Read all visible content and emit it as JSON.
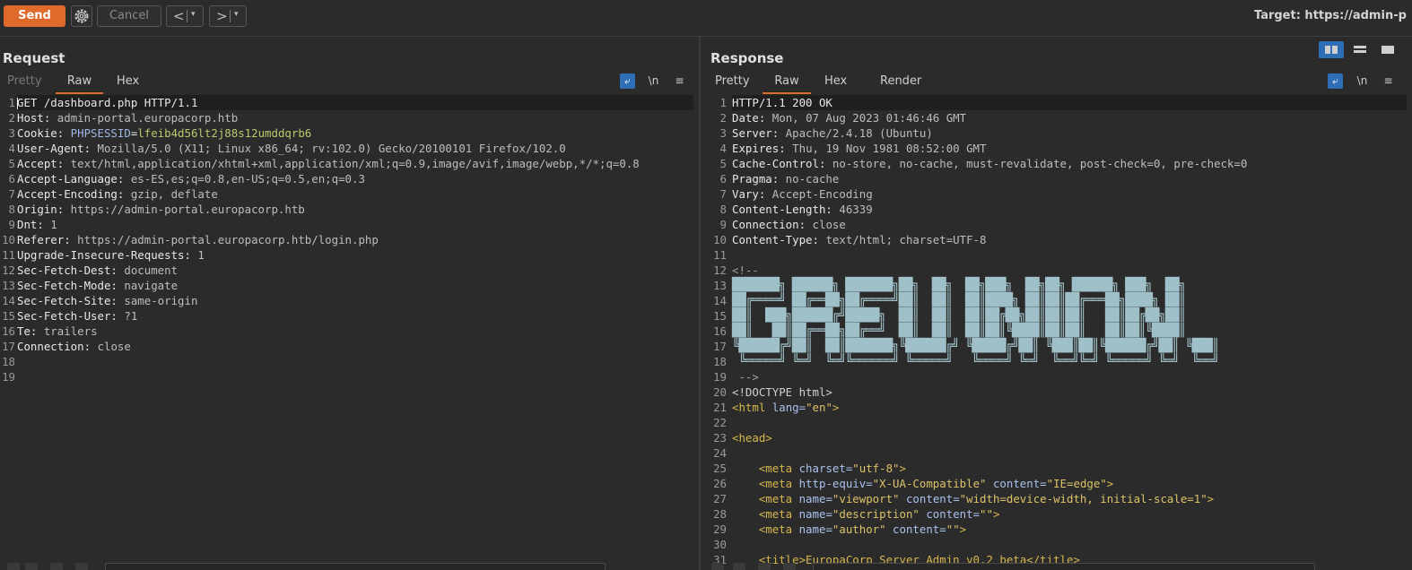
{
  "toolbar": {
    "send_label": "Send",
    "cancel_label": "Cancel",
    "back_label": "<",
    "forward_label": ">",
    "dropdown_label": "▾",
    "target_text": "Target: https://admin-p"
  },
  "request": {
    "title": "Request",
    "tabs": [
      "Pretty",
      "Raw",
      "Hex"
    ],
    "active_tab": "Raw",
    "line_numbers": [
      "1",
      "2",
      "3",
      "4",
      "5",
      "6",
      "7",
      "8",
      "9",
      "10",
      "11",
      "12",
      "13",
      "14",
      "15",
      "16",
      "17",
      "18",
      "19"
    ],
    "lines": [
      {
        "k": "GET /dashboard.php HTTP/1.1",
        "v": ""
      },
      {
        "k": "Host:",
        "v": " admin-portal.europacorp.htb"
      },
      {
        "k": "Cookie:",
        "v": "",
        "ck": " PHPSESSID",
        "eq": "=",
        "cv": "lfeib4d56lt2j88s12umddqrb6"
      },
      {
        "k": "User-Agent:",
        "v": " Mozilla/5.0 (X11; Linux x86_64; rv:102.0) Gecko/20100101 Firefox/102.0"
      },
      {
        "k": "Accept:",
        "v": " text/html,application/xhtml+xml,application/xml;q=0.9,image/avif,image/webp,*/*;q=0.8"
      },
      {
        "k": "Accept-Language:",
        "v": " es-ES,es;q=0.8,en-US;q=0.5,en;q=0.3"
      },
      {
        "k": "Accept-Encoding:",
        "v": " gzip, deflate"
      },
      {
        "k": "Origin:",
        "v": " https://admin-portal.europacorp.htb"
      },
      {
        "k": "Dnt:",
        "v": " 1"
      },
      {
        "k": "Referer:",
        "v": " https://admin-portal.europacorp.htb/login.php"
      },
      {
        "k": "Upgrade-Insecure-Requests:",
        "v": " 1"
      },
      {
        "k": "Sec-Fetch-Dest:",
        "v": " document"
      },
      {
        "k": "Sec-Fetch-Mode:",
        "v": " navigate"
      },
      {
        "k": "Sec-Fetch-Site:",
        "v": " same-origin"
      },
      {
        "k": "Sec-Fetch-User:",
        "v": " ?1"
      },
      {
        "k": "Te:",
        "v": " trailers"
      },
      {
        "k": "Connection:",
        "v": " close"
      },
      {
        "k": "",
        "v": ""
      },
      {
        "k": "",
        "v": ""
      }
    ]
  },
  "response": {
    "title": "Response",
    "tabs": [
      "Pretty",
      "Raw",
      "Hex",
      "Render"
    ],
    "active_tab": "Raw",
    "line_numbers": [
      "1",
      "2",
      "3",
      "4",
      "5",
      "6",
      "7",
      "8",
      "9",
      "10",
      "11",
      "12",
      "13",
      "14",
      "15",
      "16",
      "17",
      "18",
      "19",
      "20",
      "21",
      "22",
      "23",
      "24",
      "25",
      "26",
      "27",
      "28",
      "29",
      "30",
      "31"
    ],
    "headers": [
      {
        "k": "HTTP/1.1 200 OK",
        "v": ""
      },
      {
        "k": "Date:",
        "v": " Mon, 07 Aug 2023 01:46:46 GMT"
      },
      {
        "k": "Server:",
        "v": " Apache/2.4.18 (Ubuntu)"
      },
      {
        "k": "Expires:",
        "v": " Thu, 19 Nov 1981 08:52:00 GMT"
      },
      {
        "k": "Cache-Control:",
        "v": " no-store, no-cache, must-revalidate, post-check=0, pre-check=0"
      },
      {
        "k": "Pragma:",
        "v": " no-cache"
      },
      {
        "k": "Vary:",
        "v": " Accept-Encoding"
      },
      {
        "k": "Content-Length:",
        "v": " 46339"
      },
      {
        "k": "Connection:",
        "v": " close"
      },
      {
        "k": "Content-Type:",
        "v": " text/html; charset=UTF-8"
      }
    ],
    "comment_open": "<!--",
    "ascii_art": [
      "███████╗ ██████╗ ███████╗██╗  ██╗  ██╗███╗  ██╗██╗ ██████╗ ███╗  ██╗",
      "██╔════╝ ██╔══██╗██╔════╝██║  ██║  ██║████╗ ██║██║██╔═══██╗████╗ ██║",
      "██║  ███╗██████╔╝█████╗  ██║  ██║  ██║██╔██╗██║██║██║   ██║██╔██╗██║",
      "██║   ██║██╔══██╗██╔══╝  ██║  ██║  ██║██║╚████║██║██║   ██║██║╚████║",
      "╚██████╔╝██║  ██║███████╗╚██████╔╝ ╚█████╔╝██║ ╚███║██║╚██████╔╝██║ ╚███║",
      " ╚═════╝ ╚═╝  ╚═╝╚══════╝ ╚═════╝   ╚════╝ ╚═╝  ╚══╝╚═╝ ╚═════╝ ╚═╝  ╚══╝"
    ],
    "comment_close": " -->",
    "doctype": "<!DOCTYPE html>",
    "html_tag": {
      "open": "<html",
      "attr": " lang=",
      "val": "\"en\"",
      "close": ">"
    },
    "head_tag": "<head>",
    "meta_lines": [
      {
        "tag": "    <meta",
        "a1": " charset=",
        "v1": "\"utf-8\"",
        "a2": "",
        "v2": "",
        "end": ">"
      },
      {
        "tag": "    <meta",
        "a1": " http-equiv=",
        "v1": "\"X-UA-Compatible\"",
        "a2": " content=",
        "v2": "\"IE=edge\"",
        "end": ">"
      },
      {
        "tag": "    <meta",
        "a1": " name=",
        "v1": "\"viewport\"",
        "a2": " content=",
        "v2": "\"width=device-width, initial-scale=1\"",
        "end": ">"
      },
      {
        "tag": "    <meta",
        "a1": " name=",
        "v1": "\"description\"",
        "a2": " content=",
        "v2": "\"\"",
        "end": ">"
      },
      {
        "tag": "    <meta",
        "a1": " name=",
        "v1": "\"author\"",
        "a2": " content=",
        "v2": "\"\"",
        "end": ">"
      }
    ],
    "title_line": "    <title>EuropaCorp Server Admin v0.2 beta</title>"
  },
  "colors": {
    "accent": "#e06a2b",
    "selected_blue": "#2f6db6"
  }
}
